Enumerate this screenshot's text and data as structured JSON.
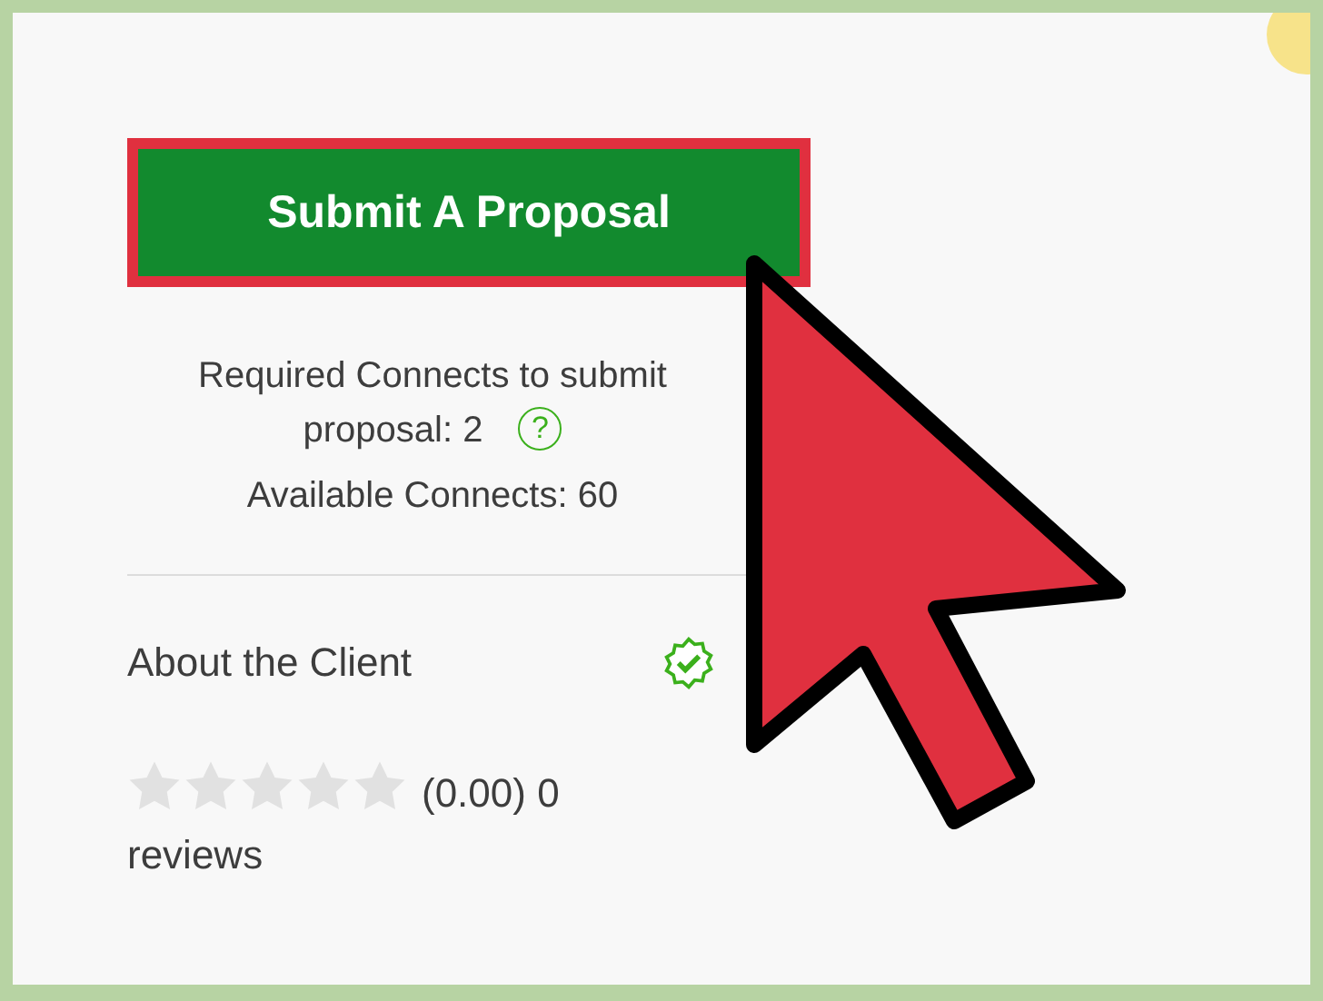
{
  "submit_button": {
    "label": "Submit A Proposal"
  },
  "connects": {
    "required": "Required Connects to submit proposal: 2",
    "help_icon": "?",
    "available": "Available Connects: 60"
  },
  "about_client": {
    "title": "About the Client",
    "verified": true,
    "stars": 0,
    "rating": "(0.00) 0 reviews"
  }
}
